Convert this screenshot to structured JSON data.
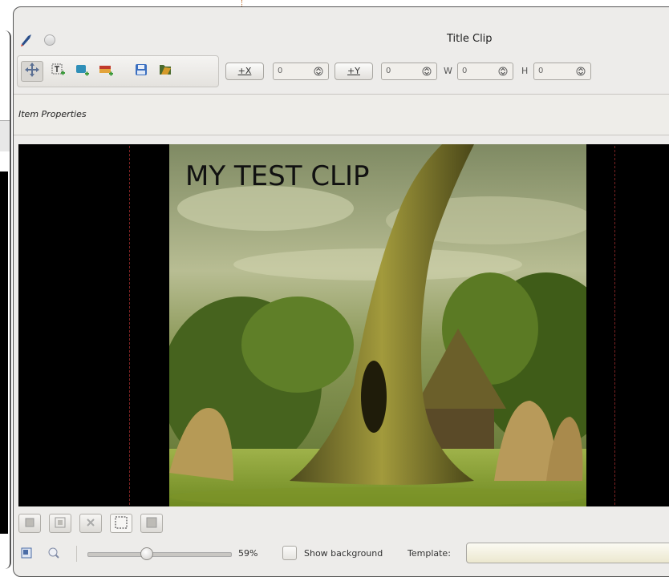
{
  "window": {
    "title": "Title Clip"
  },
  "toolbar": {
    "tools": [
      {
        "icon": "move-icon"
      },
      {
        "icon": "add-text-icon"
      },
      {
        "icon": "add-rectangle-icon"
      },
      {
        "icon": "add-image-icon"
      },
      {
        "icon": "save-icon"
      },
      {
        "icon": "open-icon"
      }
    ],
    "x_button": "+X",
    "x_value": "0",
    "y_button": "+Y",
    "y_value": "0",
    "w_label": "W",
    "w_value": "0",
    "h_label": "H",
    "h_value": "0"
  },
  "item_properties": {
    "label": "Item Properties"
  },
  "canvas": {
    "clip_text": "MY TEST CLIP"
  },
  "bottom": {
    "zoom_value": "59%",
    "zoom_level": 0.59,
    "show_background_label": "Show background",
    "show_background_checked": false,
    "template_label": "Template:",
    "template_value": ""
  },
  "colors": {
    "canvas_bg": "#000000",
    "window_bg": "#edecea",
    "guide": "#7a2222"
  }
}
